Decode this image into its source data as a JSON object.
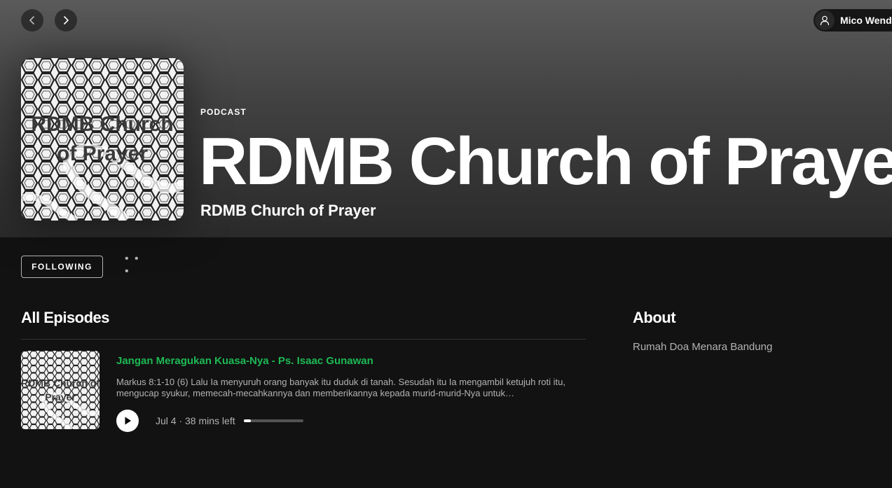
{
  "header": {
    "back_icon": "chevron-left-icon",
    "forward_icon": "chevron-right-icon",
    "user": {
      "name": "Mico Wendy",
      "icon": "user-icon"
    }
  },
  "podcast": {
    "kind_label": "PODCAST",
    "title": "RDMB Church of Prayer",
    "publisher": "RDMB Church of Prayer",
    "cover_text": "RDMB Church of Prayer"
  },
  "actions": {
    "follow_label": "FOLLOWING",
    "more_label": "• • •"
  },
  "episodes": {
    "heading": "All Episodes",
    "items": [
      {
        "thumb_text": "RDMB Church of Prayer",
        "title": "Jangan Meragukan Kuasa-Nya - Ps. Isaac Gunawan",
        "description": "Markus 8:1-10 (6) Lalu Ia menyuruh orang banyak itu duduk di tanah. Sesudah itu Ia mengambil ketujuh roti itu, mengucap syukur, memecah-mecahkannya dan memberikannya kepada murid-murid-Nya untuk…",
        "meta": "Jul 4 · 38 mins left",
        "progress_fraction": 0.12
      }
    ]
  },
  "about": {
    "heading": "About",
    "text": "Rumah Doa Menara Bandung"
  },
  "colors": {
    "accent": "#1db954",
    "background": "#121212",
    "muted_text": "#b3b3b3"
  }
}
